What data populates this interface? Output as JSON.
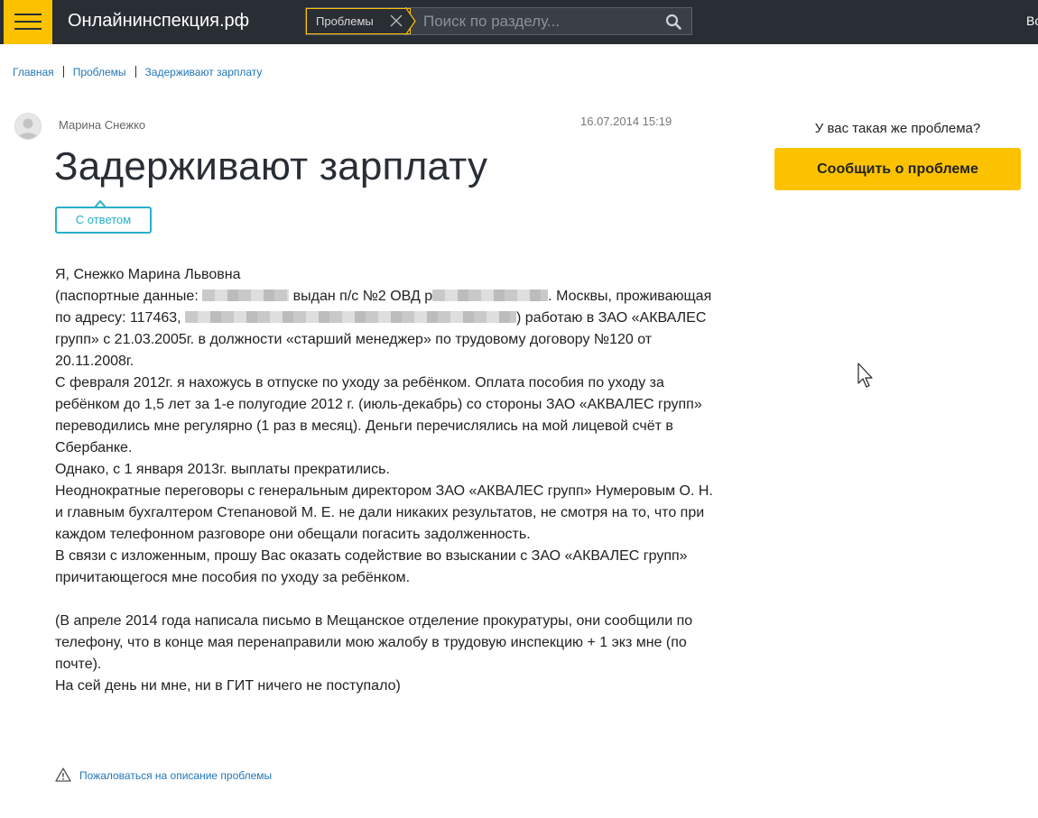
{
  "header": {
    "site_title": "Онлайнинспекция.рф",
    "search": {
      "chip_label": "Проблемы",
      "placeholder": "Поиск по разделу..."
    },
    "right_text": "Во"
  },
  "breadcrumbs": [
    "Главная",
    "Проблемы",
    "Задерживают зарплату"
  ],
  "post": {
    "author": "Марина Снежко",
    "date": "16.07.2014 15:19",
    "title": "Задерживают зарплату",
    "badge": "С ответом",
    "lines": {
      "l1": "Я, Снежко Марина Львовна",
      "l2a": "(паспортные данные: ",
      "l2b": " выдан п/с №2 ОВД р",
      "l2c": ". Москвы, проживающая",
      "l3a": "по адресу: 117463, ",
      "l3b": ") работаю в ЗАО «АКВАЛЕС",
      "l4": "групп» с 21.03.2005г. в должности «старший менеджер» по трудовому договору №120 от",
      "l5": "20.11.2008г.",
      "l6": "С февраля 2012г. я нахожусь в отпуске по уходу за ребёнком. Оплата пособия по уходу за",
      "l7": "ребёнком до 1,5 лет за 1-е полугодие 2012 г. (июль-декабрь) со стороны ЗАО «АКВАЛЕС групп»",
      "l8": "переводились мне регулярно (1 раз в месяц). Деньги перечислялись на мой лицевой счёт в",
      "l9": "Сбербанке.",
      "l10": "Однако, с 1 января 2013г. выплаты прекратились.",
      "l11": "Неоднократные переговоры с генеральным директором ЗАО «АКВАЛЕС групп» Нумеровым О. Н.",
      "l12": "и главным бухгалтером Степановой М. Е. не дали никаких результатов, не смотря на то, что при",
      "l13": "каждом телефонном разговоре они обещали погасить задолженность.",
      "l14": "В связи с изложенным, прошу Вас оказать содействие во взыскании с ЗАО «АКВАЛЕС групп»",
      "l15": "причитающегося мне пособия по уходу за ребёнком.",
      "l16": "(В апреле 2014 года написала письмо в Мещанское отделение прокуратуры, они сообщили по",
      "l17": "телефону, что в конце мая перенаправили мою жалобу в трудовую инспекцию + 1 экз мне (по",
      "l18": "почте).",
      "l19": "На сей день ни мне, ни в ГИТ ничего не поступало)"
    }
  },
  "sidebar": {
    "question": "У вас такая же проблема?",
    "report_button": "Сообщить о проблеме"
  },
  "footer": {
    "complain_link": "Пожаловаться на описание проблемы"
  },
  "icons": {
    "menu": "hamburger-menu-icon",
    "close": "close-icon",
    "search": "search-icon",
    "avatar": "user-avatar-icon",
    "warning": "warning-icon",
    "cursor": "mouse-pointer-icon"
  },
  "colors": {
    "accent": "#fcc200",
    "topbar": "#292e35",
    "link": "#2277b8",
    "badge": "#27b0c9"
  }
}
